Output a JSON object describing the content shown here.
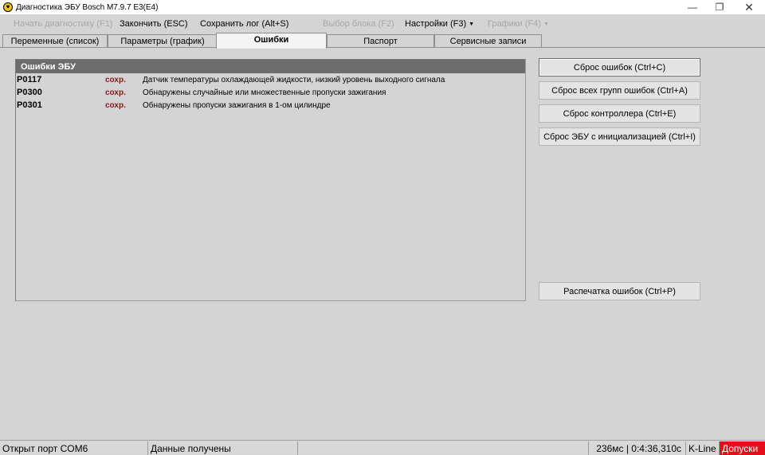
{
  "window": {
    "title": "Диагностика ЭБУ Bosch M7.9.7 Е3(Е4)",
    "app_icon_glyph": "♥",
    "minimize": "—",
    "maximize": "❐",
    "close": "✕"
  },
  "menu": {
    "items": [
      {
        "label": "Начать диагностику (F1)",
        "enabled": false
      },
      {
        "label": "Закончить (ESC)",
        "enabled": true
      },
      {
        "label": "Сохранить лог (Alt+S)",
        "enabled": true
      },
      {
        "label": "Выбор блока (F2)",
        "enabled": false
      },
      {
        "label": "Настройки (F3)",
        "enabled": true,
        "dropdown": true
      },
      {
        "label": "Графики (F4)",
        "enabled": false,
        "dropdown": true
      }
    ]
  },
  "tabs": [
    {
      "label": "Переменные (список)",
      "active": false
    },
    {
      "label": "Параметры (график)",
      "active": false
    },
    {
      "label": "Ошибки",
      "active": true
    },
    {
      "label": "Паспорт",
      "active": false
    },
    {
      "label": "Сервисные записи",
      "active": false
    }
  ],
  "errors_panel": {
    "title": "Ошибки ЭБУ",
    "rows": [
      {
        "code": "P0117",
        "status": "сохр.",
        "description": "Датчик температуры охлаждающей жидкости, низкий уровень выходного сигнала"
      },
      {
        "code": "P0300",
        "status": "сохр.",
        "description": "Обнаружены случайные или множественные пропуски зажигания"
      },
      {
        "code": "P0301",
        "status": "сохр.",
        "description": "Обнаружены пропуски зажигания в 1-ом цилиндре"
      }
    ]
  },
  "actions": {
    "reset_errors": "Сброс ошибок (Ctrl+C)",
    "reset_all_groups": "Сброс всех групп ошибок (Ctrl+A)",
    "reset_controller": "Сброс контроллера (Ctrl+E)",
    "reset_ecu_init": "Сброс ЭБУ с инициализацией (Ctrl+I)",
    "print_errors": "Распечатка ошибок (Ctrl+P)"
  },
  "statusbar": {
    "port": "Открыт порт COM6",
    "data": "Данные получены",
    "empty": "",
    "timing": "236мс | 0:4:36,310с",
    "line": "K-Line",
    "tolerances": "Допуски",
    "alert_color": "#e3101c"
  }
}
